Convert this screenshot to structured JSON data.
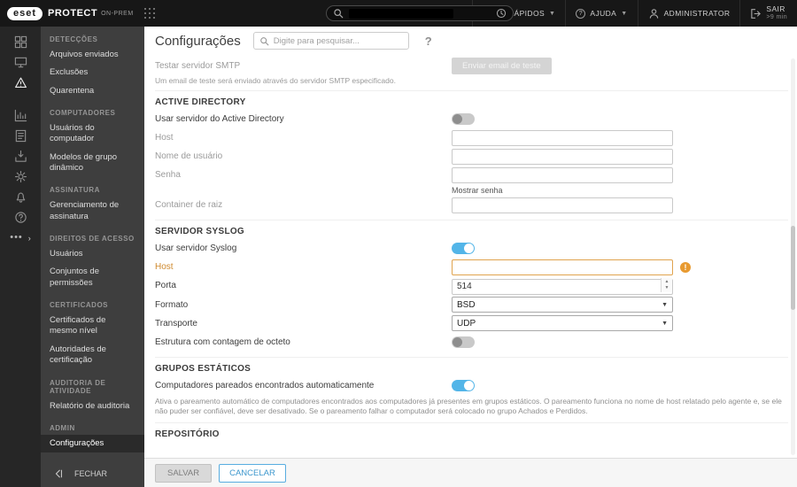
{
  "topbar": {
    "logo_text": "eset",
    "product_name": "PROTECT",
    "edition": "ON-PREM",
    "quick_links_label": "LINKS RÁPIDOS",
    "help_label": "AJUDA",
    "user_label": "ADMINISTRATOR",
    "logout_label": "SAIR",
    "session_timeout": ">9 min"
  },
  "sidebar": {
    "sections": [
      {
        "title": "DETECÇÕES",
        "items": [
          {
            "label": "Arquivos enviados"
          },
          {
            "label": "Exclusões"
          },
          {
            "label": "Quarentena"
          }
        ]
      },
      {
        "title": "COMPUTADORES",
        "items": [
          {
            "label": "Usuários do computador"
          },
          {
            "label": "Modelos de grupo dinâmico"
          }
        ]
      },
      {
        "title": "ASSINATURA",
        "items": [
          {
            "label": "Gerenciamento de assinatura"
          }
        ]
      },
      {
        "title": "DIREITOS DE ACESSO",
        "items": [
          {
            "label": "Usuários"
          },
          {
            "label": "Conjuntos de permissões"
          }
        ]
      },
      {
        "title": "CERTIFICADOS",
        "items": [
          {
            "label": "Certificados de mesmo nível"
          },
          {
            "label": "Autoridades de certificação"
          }
        ]
      },
      {
        "title": "AUDITORIA DE ATIVIDADE",
        "items": [
          {
            "label": "Relatório de auditoria"
          }
        ]
      },
      {
        "title": "ADMIN",
        "items": [
          {
            "label": "Configurações",
            "selected": true
          }
        ]
      }
    ],
    "close_label": "FECHAR"
  },
  "main": {
    "title": "Configurações",
    "search_placeholder": "Digite para pesquisar...",
    "help_icon": "?",
    "smtp_test": {
      "label": "Testar servidor SMTP",
      "button_label": "Enviar email de teste",
      "note": "Um email de teste será enviado através do servidor SMTP especificado."
    },
    "active_directory": {
      "title": "ACTIVE DIRECTORY",
      "use_label": "Usar servidor do Active Directory",
      "use_enabled": false,
      "host_label": "Host",
      "host_value": "",
      "username_label": "Nome de usuário",
      "username_value": "",
      "password_label": "Senha",
      "password_value": "",
      "show_password_label": "Mostrar senha",
      "root_container_label": "Container de raiz",
      "root_container_value": ""
    },
    "syslog": {
      "title": "SERVIDOR SYSLOG",
      "use_label": "Usar servidor Syslog",
      "use_enabled": true,
      "host_label": "Host",
      "host_value": "",
      "host_invalid": true,
      "port_label": "Porta",
      "port_value": "514",
      "format_label": "Formato",
      "format_value": "BSD",
      "transport_label": "Transporte",
      "transport_value": "UDP",
      "octet_framing_label": "Estrutura com contagem de octeto",
      "octet_framing_enabled": false
    },
    "static_groups": {
      "title": "GRUPOS ESTÁTICOS",
      "pairing_label": "Computadores pareados encontrados automaticamente",
      "pairing_enabled": true,
      "description": "Ativa o pareamento automático de computadores encontrados aos computadores já presentes em grupos estáticos. O pareamento funciona no nome de host relatado pelo agente e, se ele não puder ser confiável, deve ser desativado. Se o pareamento falhar o computador será colocado no grupo Achados e Perdidos."
    },
    "repository": {
      "title": "REPOSITÓRIO"
    },
    "footer": {
      "save_label": "SALVAR",
      "cancel_label": "CANCELAR"
    }
  },
  "colors": {
    "accent_blue": "#53b5e8",
    "warning_orange": "#e89a30",
    "topbar_bg": "#171717",
    "rail_bg": "#262626",
    "submenu_bg": "#3e3e3e"
  },
  "icons": {
    "topbar": [
      "apps-grid-icon",
      "search-icon",
      "clock-icon",
      "chevron-down-icon",
      "help-circle-icon",
      "user-icon",
      "logout-icon"
    ],
    "rail": [
      "dashboard-icon",
      "computers-icon",
      "detections-icon",
      "reports-icon",
      "tasks-icon",
      "installers-icon",
      "policies-icon",
      "notifications-icon",
      "status-overview-icon",
      "more-icon"
    ],
    "content": [
      "search-icon",
      "help-icon",
      "warning-icon",
      "spinner-icon",
      "collapse-icon"
    ]
  }
}
